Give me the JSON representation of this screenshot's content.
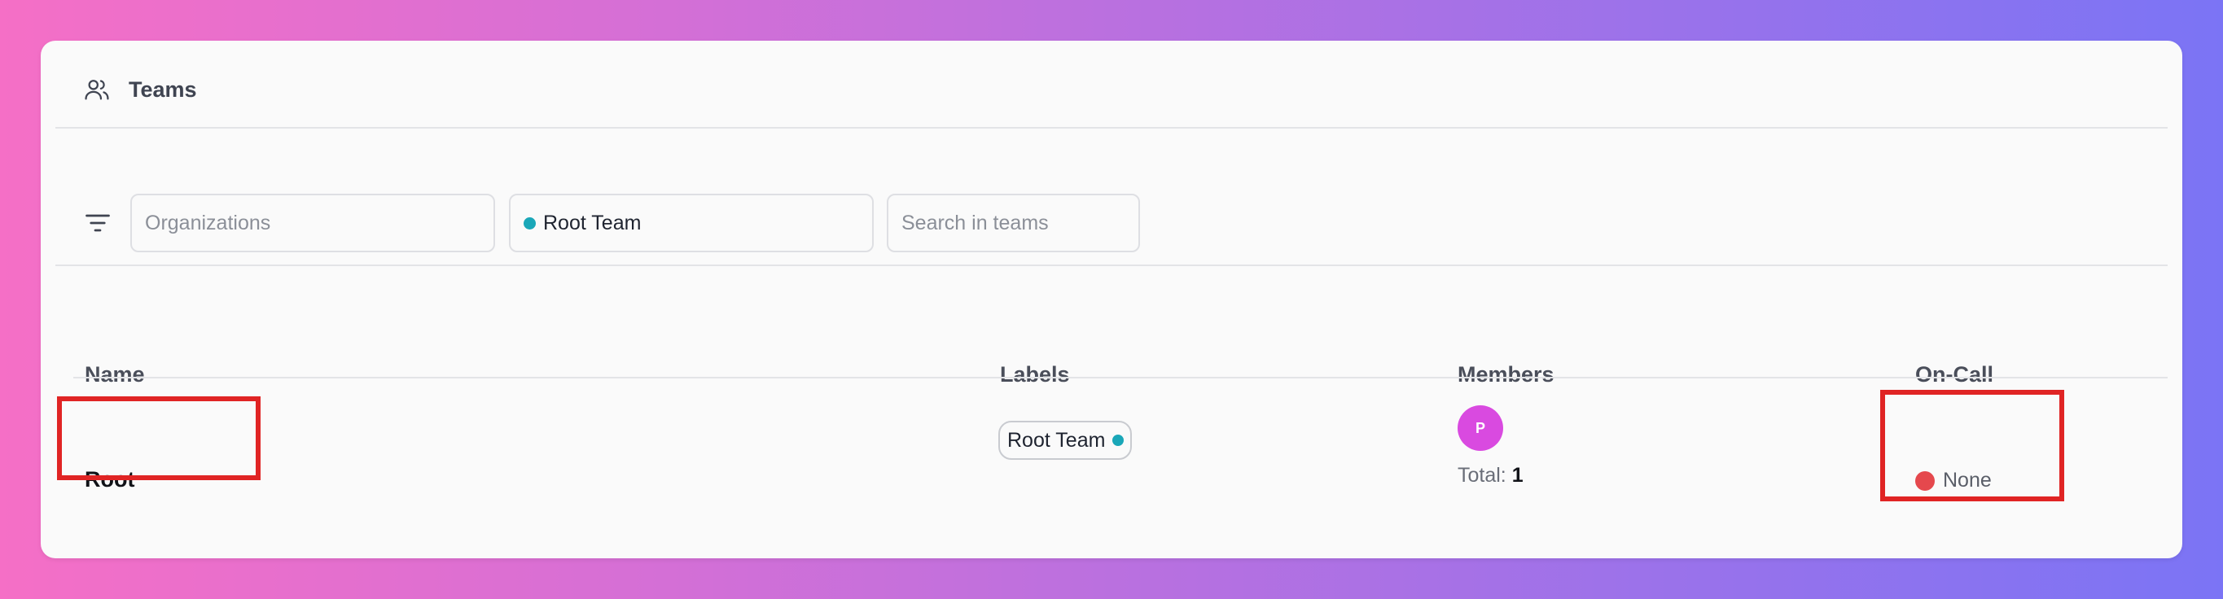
{
  "header": {
    "icon": "users-icon",
    "title": "Teams"
  },
  "filters": {
    "filter_icon": "filter-icon",
    "organizations_placeholder": "Organizations",
    "label_filter_value": "Root Team",
    "label_filter_color": "#1aa7b8",
    "search_placeholder": "Search in teams"
  },
  "table": {
    "columns": [
      "Name",
      "Labels",
      "Members",
      "On-Call"
    ],
    "rows": [
      {
        "name": "Root",
        "label": "Root Team",
        "label_color": "#1aa7b8",
        "member_avatar_initial": "P",
        "members_total_label": "Total:",
        "members_total_value": "1",
        "oncall_status": "None",
        "oncall_status_color": "#e5484d"
      }
    ]
  },
  "colors": {
    "highlight": "#e02424",
    "avatar": "#d94ae0"
  }
}
